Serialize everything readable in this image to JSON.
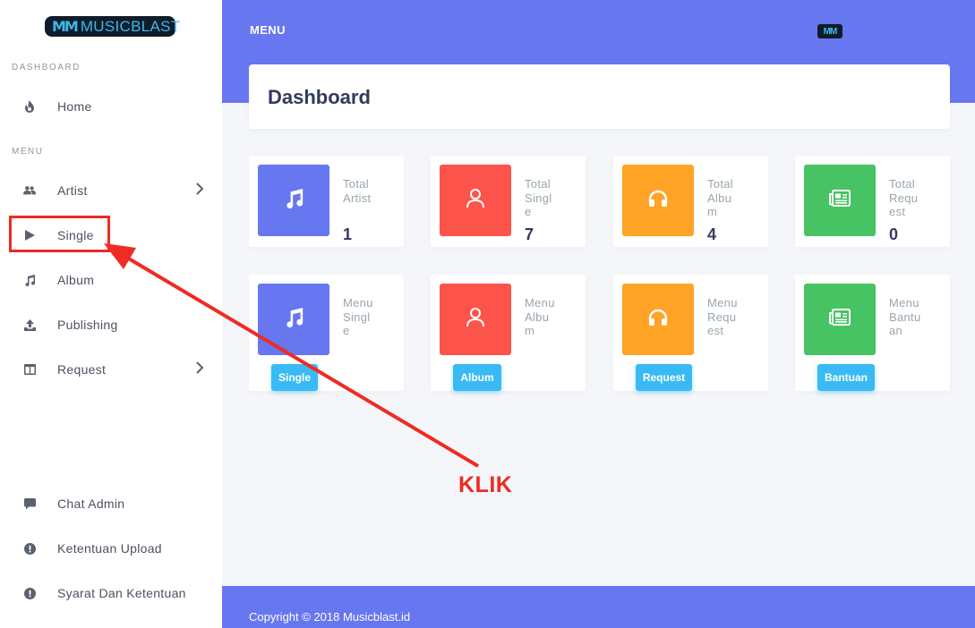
{
  "brand": {
    "logo_mark": "MM",
    "logo_text": "MUSICBLAST",
    "top_logo_mark": "MM"
  },
  "sidebar": {
    "section_dashboard": "DASHBOARD",
    "section_menu": "MENU",
    "items": [
      {
        "label": "Home",
        "icon": "fire-icon"
      },
      {
        "label": "Artist",
        "icon": "users-icon"
      },
      {
        "label": "Single",
        "icon": "play-icon"
      },
      {
        "label": "Album",
        "icon": "music-note-icon"
      },
      {
        "label": "Publishing",
        "icon": "upload-icon"
      },
      {
        "label": "Request",
        "icon": "columns-icon"
      }
    ],
    "bottom_items": [
      {
        "label": "Chat Admin",
        "icon": "chat-icon"
      },
      {
        "label": "Ketentuan Upload",
        "icon": "exclamation-icon"
      },
      {
        "label": "Syarat Dan Ketentuan",
        "icon": "exclamation-icon"
      }
    ]
  },
  "header": {
    "title": "MENU"
  },
  "page": {
    "title": "Dashboard"
  },
  "stats": [
    {
      "label": "Total Artist",
      "value": "1",
      "color": "#6777ef",
      "icon": "music-note-icon"
    },
    {
      "label": "Total Single",
      "value": "7",
      "color": "#fc544b",
      "icon": "user-icon"
    },
    {
      "label": "Total Album",
      "value": "4",
      "color": "#ffa426",
      "icon": "headphones-icon"
    },
    {
      "label": "Total Request",
      "value": "0",
      "color": "#47c363",
      "icon": "newspaper-icon"
    }
  ],
  "menus": [
    {
      "label": "Menu Single",
      "button": "Single",
      "color": "#6777ef",
      "icon": "music-note-icon"
    },
    {
      "label": "Menu Album",
      "button": "Album",
      "color": "#fc544b",
      "icon": "user-icon"
    },
    {
      "label": "Menu Request",
      "button": "Request",
      "color": "#ffa426",
      "icon": "headphones-icon"
    },
    {
      "label": "Menu Bantuan",
      "button": "Bantuan",
      "color": "#47c363",
      "icon": "newspaper-icon"
    }
  ],
  "footer": {
    "copyright": "Copyright © 2018 Musicblast.id"
  },
  "annotation": {
    "text": "KLIK",
    "color": "#ee2b24"
  }
}
